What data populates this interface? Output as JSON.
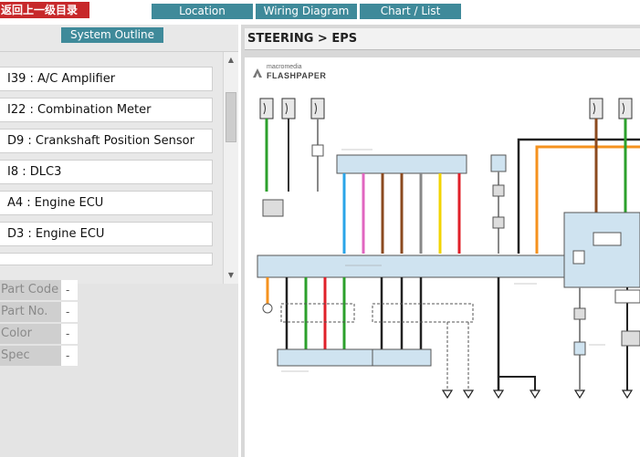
{
  "header": {
    "back_label": "返回上一级目录",
    "nav": [
      {
        "label": "Location"
      },
      {
        "label": "Wiring Diagram"
      },
      {
        "label": "Chart / List"
      }
    ]
  },
  "sidebar": {
    "outline_label": "System Outline",
    "items": [
      {
        "label": "I39 : A/C Amplifier"
      },
      {
        "label": "I22 : Combination Meter"
      },
      {
        "label": "D9 : Crankshaft Position Sensor"
      },
      {
        "label": "I8 : DLC3"
      },
      {
        "label": "A4 : Engine ECU"
      },
      {
        "label": "D3 : Engine ECU"
      }
    ],
    "properties": [
      {
        "label": "Part Code",
        "value": "-"
      },
      {
        "label": "Part No.",
        "value": "-"
      },
      {
        "label": "Color",
        "value": "-"
      },
      {
        "label": "Spec",
        "value": "-"
      }
    ]
  },
  "main": {
    "breadcrumb": "STEERING > EPS",
    "viewer": {
      "logo_top": "macromedia",
      "logo_bottom": "FLASHPAPER"
    }
  },
  "colors": {
    "nav_teal": "#3f8a9a",
    "back_red": "#c7282a",
    "wire_green": "#2ca02c",
    "wire_red": "#e0202a",
    "wire_blue": "#2aa5e8",
    "wire_pink": "#e066c0",
    "wire_brown": "#8b4a1f",
    "wire_yellow": "#f2d400",
    "wire_orange": "#f5921e",
    "module_fill": "#cfe3f0"
  }
}
